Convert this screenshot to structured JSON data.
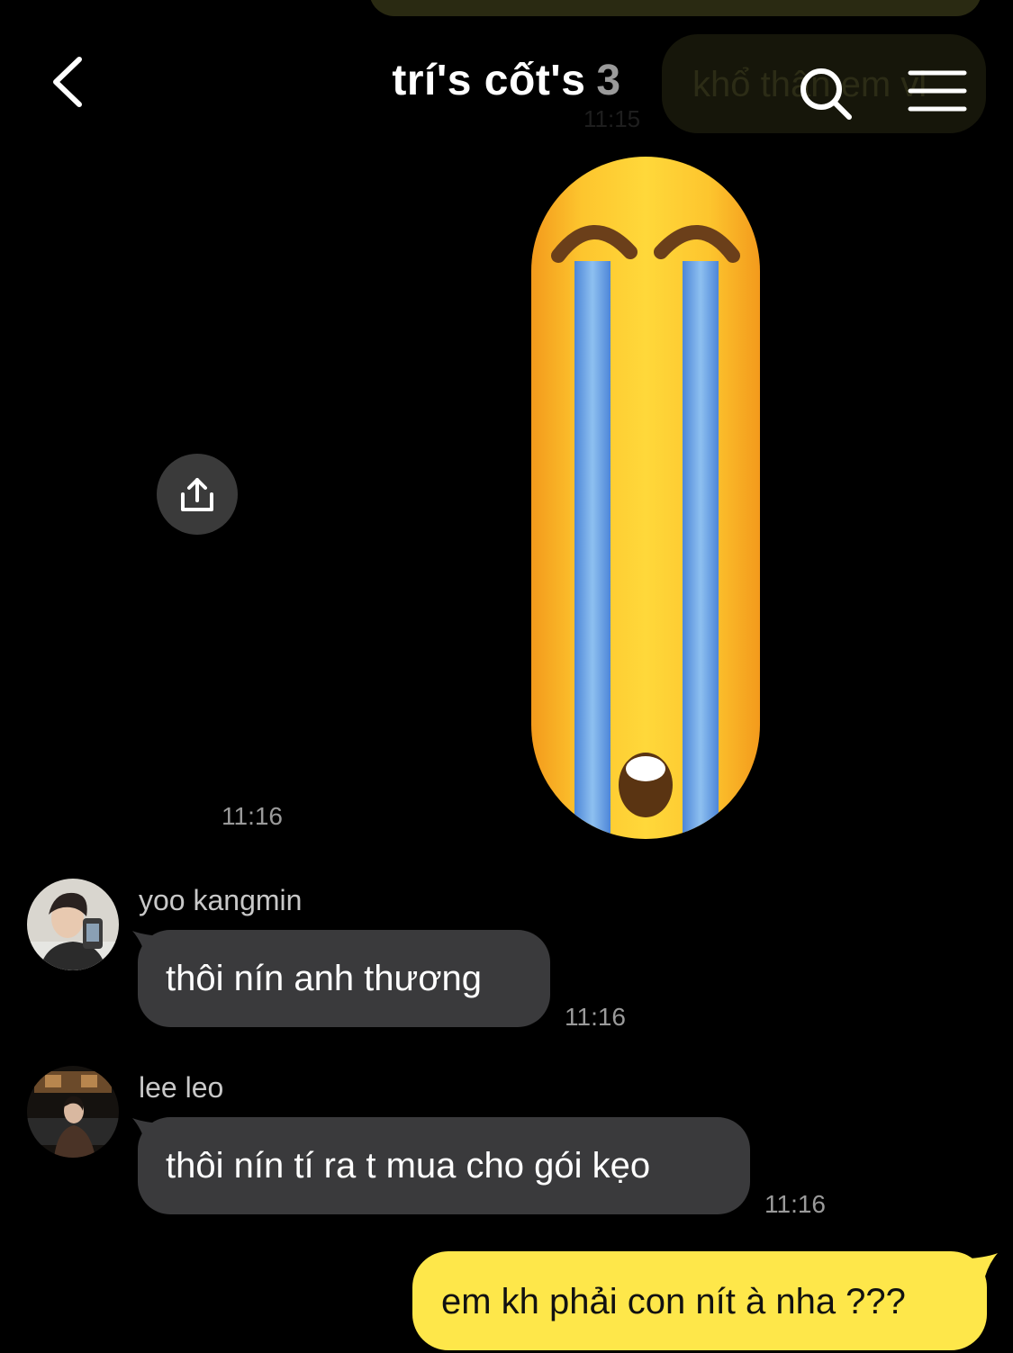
{
  "header": {
    "title": "trí's cốt's",
    "member_count": "3",
    "back_icon": "chevron-left-icon",
    "search_icon": "search-icon",
    "menu_icon": "hamburger-menu-icon"
  },
  "previous_message": {
    "text": "khổ thân em vl",
    "time": "11:15"
  },
  "sticker_message": {
    "emoji": "loudly-crying-face-emoji",
    "time": "11:16",
    "share_icon": "share-upload-icon"
  },
  "messages": [
    {
      "sender": "yoo kangmin",
      "text": "thôi nín anh thương",
      "time": "11:16"
    },
    {
      "sender": "lee leo",
      "text": "thôi nín tí ra t mua cho gói kẹo",
      "time": "11:16"
    }
  ],
  "my_message": {
    "text": "em kh phải con nít à nha ???"
  },
  "colors": {
    "background": "#000000",
    "incoming_bubble": "#3a3a3c",
    "outgoing_bubble": "#fee74a",
    "secondary_text": "#9a9a9a"
  }
}
